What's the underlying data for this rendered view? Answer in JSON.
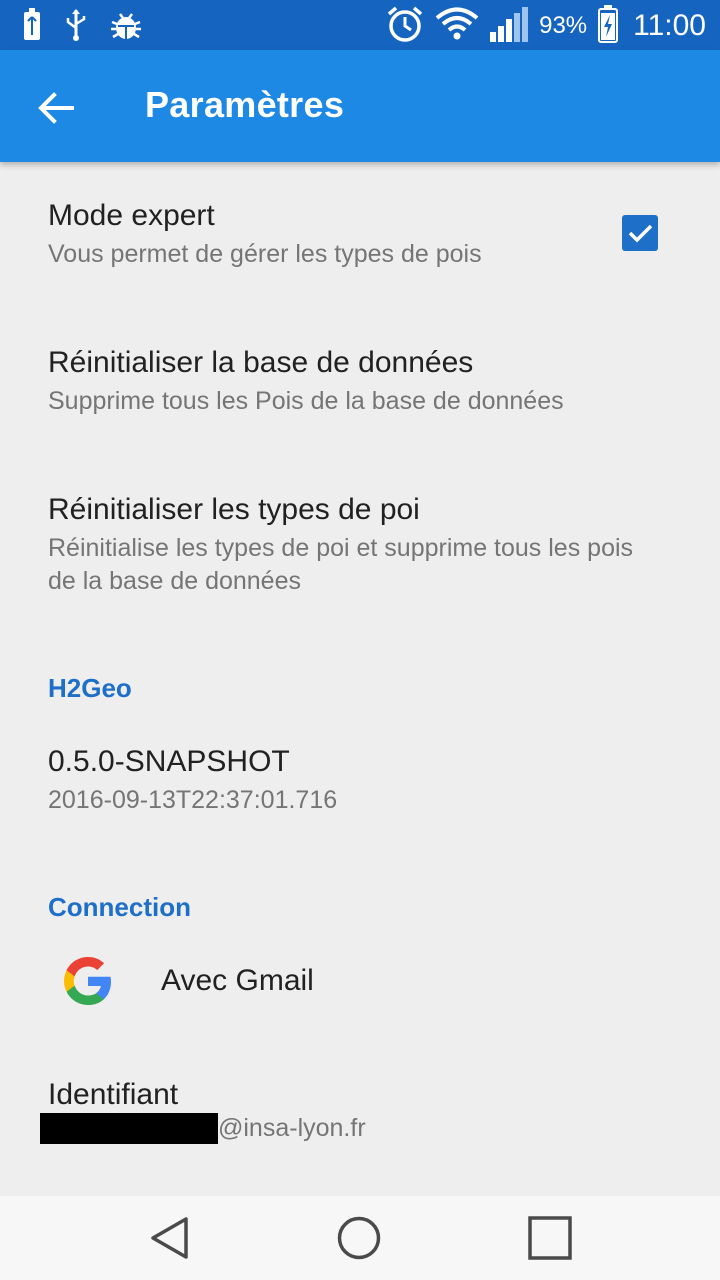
{
  "status_bar": {
    "battery_percent": "93%",
    "time": "11:00",
    "left_icons": [
      "battery-charging-icon",
      "usb-icon",
      "debug-bug-icon"
    ],
    "right_icons": [
      "alarm-icon",
      "wifi-icon",
      "signal-icon",
      "battery-icon"
    ]
  },
  "app_bar": {
    "title": "Paramètres",
    "color": "#1e88e5",
    "status_color": "#1565c0"
  },
  "preferences": {
    "mode_expert": {
      "title": "Mode expert",
      "summary": "Vous permet de gérer les types de pois",
      "checked": true
    },
    "reset_db": {
      "title": "Réinitialiser la base de données",
      "summary": "Supprime tous les Pois de la base de données"
    },
    "reset_types": {
      "title": "Réinitialiser les types de poi",
      "summary": "Réinitialise les types de poi et supprime tous les pois de la base de données"
    }
  },
  "h2geo": {
    "category": "H2Geo",
    "version": "0.5.0-SNAPSHOT",
    "build_date": "2016-09-13T22:37:01.716"
  },
  "connection": {
    "category": "Connection",
    "gmail_label": "Avec Gmail",
    "identifiant_title": "Identifiant",
    "identifiant_domain": "@insa-lyon.fr"
  },
  "nav": {
    "icons": [
      "back-triangle-icon",
      "home-circle-icon",
      "recents-square-icon"
    ]
  },
  "accent_color": "#1e6fc7"
}
